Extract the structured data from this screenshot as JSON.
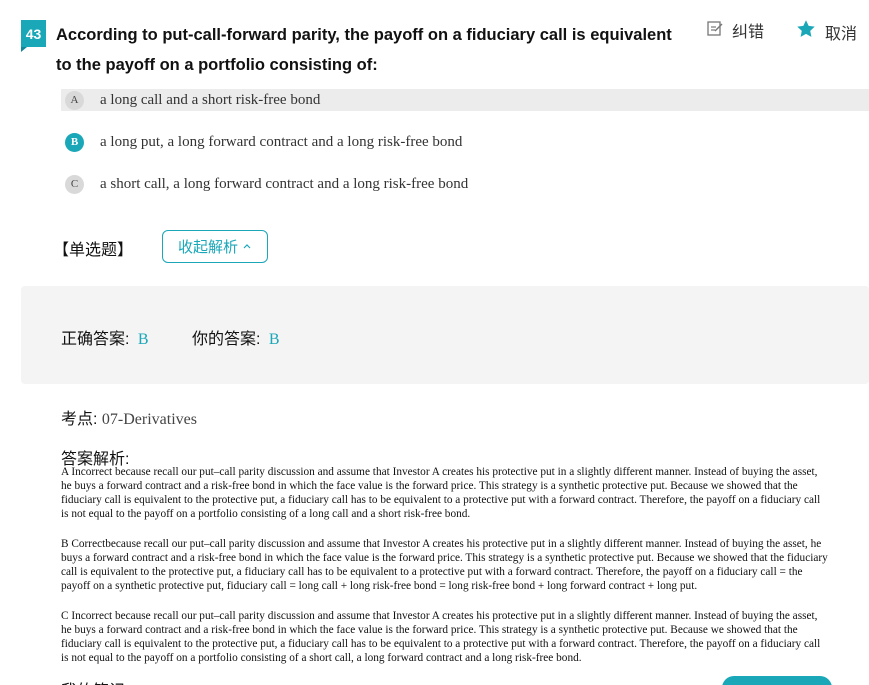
{
  "question": {
    "number": "43",
    "text": "According to put-call-forward parity, the payoff on a fiduciary call is equivalent to the payoff on a portfolio consisting of:"
  },
  "toolbar": {
    "correct_label": "纠错",
    "cancel_label": "取消",
    "accent_color": "#1aa7b8"
  },
  "options": [
    {
      "letter": "A",
      "text": "a long call and a short risk-free bond",
      "highlighted": true,
      "selected": false
    },
    {
      "letter": "B",
      "text": "a long put, a long forward contract and a long risk-free bond",
      "highlighted": false,
      "selected": true
    },
    {
      "letter": "C",
      "text": "a short call, a long forward contract and a long risk-free bond",
      "highlighted": false,
      "selected": false
    }
  ],
  "question_type": "【单选题】",
  "collapse_button": "收起解析",
  "answer": {
    "correct_label": "正确答案:",
    "correct_value": "B",
    "yours_label": "你的答案:",
    "yours_value": "B"
  },
  "knowledge_point": {
    "label": "考点:",
    "value": "07-Derivatives"
  },
  "analysis": {
    "title": "答案解析:",
    "paragraphs": [
      "A Incorrect because recall our put–call parity discussion and assume that Investor A creates his protective put in a slightly different manner. Instead of buying the asset, he buys a forward contract and a risk-free bond in which the face value is the forward price. This strategy is a synthetic protective put. Because we showed that the fiduciary call is equivalent to the protective put, a fiduciary call has to be equivalent to a protective put with a forward contract. Therefore, the payoff on a fiduciary call is not equal to the payoff on a portfolio consisting of a long call and a short risk-free bond.",
      "B Correctbecause recall our put–call parity discussion and assume that Investor A creates his protective put in a slightly different manner. Instead of buying the asset, he buys a forward contract and a risk-free bond in which the face value is the forward price. This strategy is a synthetic protective put. Because we showed that the fiduciary call is equivalent to the protective put, a fiduciary call has to be equivalent to a protective put with a forward contract. Therefore, the payoff on a fiduciary call = the payoff on a synthetic protective put, fiduciary call = long call + long risk-free bond = long risk-free bond + long forward contract + long put.",
      "C Incorrect because recall our put–call parity discussion and assume that Investor A creates his protective put in a slightly different manner. Instead of buying the asset, he buys a forward contract and a risk-free bond in which the face value is the forward price. This strategy is a synthetic protective put. Because we showed that the fiduciary call is equivalent to the protective put, a fiduciary call has to be equivalent to a protective put with a forward contract. Therefore, the payoff on a fiduciary call is not equal to the payoff on a portfolio consisting of a short call, a long forward contract and a long risk-free bond."
    ]
  },
  "notes_heading": "我的笔记"
}
